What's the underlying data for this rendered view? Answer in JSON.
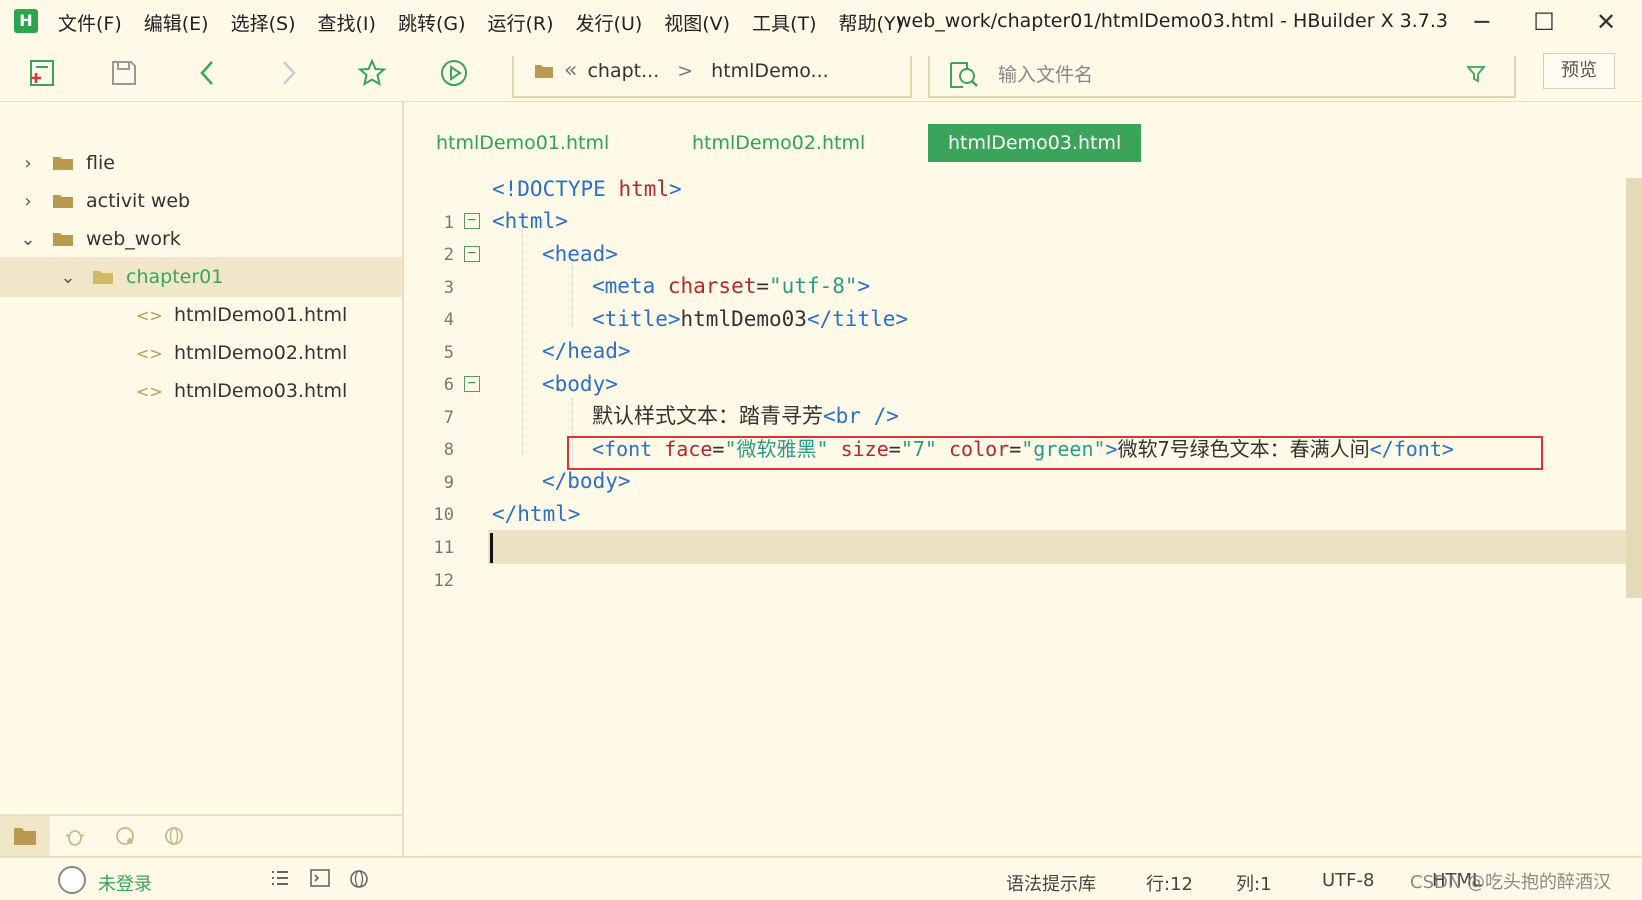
{
  "window": {
    "title": "web_work/chapter01/htmlDemo03.html - HBuilder X 3.7.3",
    "logo_text": "H",
    "minimize": "─",
    "maximize": "☐",
    "close": "✕"
  },
  "menu": [
    "文件(F)",
    "编辑(E)",
    "选择(S)",
    "查找(I)",
    "跳转(G)",
    "运行(R)",
    "发行(U)",
    "视图(V)",
    "工具(T)",
    "帮助(Y)"
  ],
  "breadcrumb": {
    "back_glyph": "«",
    "items": [
      "chapt...",
      "htmlDemo..."
    ],
    "separator": ">"
  },
  "search": {
    "placeholder": "输入文件名"
  },
  "toolbar": {
    "preview_label": "预览"
  },
  "sidebar": {
    "items": [
      {
        "label": "flie",
        "chevron": "›",
        "level": 0
      },
      {
        "label": "activit web",
        "chevron": "›",
        "level": 0
      },
      {
        "label": "web_work",
        "chevron": "⌄",
        "level": 0
      },
      {
        "label": "chapter01",
        "chevron": "⌄",
        "level": 1
      },
      {
        "label": "htmlDemo01.html",
        "icon": "<>",
        "level": 2
      },
      {
        "label": "htmlDemo02.html",
        "icon": "<>",
        "level": 2
      },
      {
        "label": "htmlDemo03.html",
        "icon": "<>",
        "level": 2
      }
    ]
  },
  "tabs": [
    "htmlDemo01.html",
    "htmlDemo02.html",
    "htmlDemo03.html"
  ],
  "editor": {
    "line_numbers": [
      "1",
      "2",
      "3",
      "4",
      "5",
      "6",
      "7",
      "8",
      "9",
      "10",
      "11",
      "12"
    ],
    "fold_marker": "−",
    "tokens": {
      "l1_a": "<!DOCTYPE ",
      "l1_b": "html",
      "l1_c": ">",
      "l2": "<html>",
      "l3": "<head>",
      "l4_a": "<meta ",
      "l4_b": "charset",
      "l4_c": "=",
      "l4_d": "\"utf-8\"",
      "l4_e": ">",
      "l5_a": "<title>",
      "l5_b": "htmlDemo03",
      "l5_c": "</title>",
      "l6": "</head>",
      "l7": "<body>",
      "l8_a": "默认样式文本：踏青寻芳",
      "l8_b": "<br />",
      "l9_a": "<font ",
      "l9_b": "face",
      "l9_c": "=",
      "l9_d": "\"微软雅黑\"",
      "l9_e": " size",
      "l9_f": "=",
      "l9_g": "\"7\"",
      "l9_h": " color",
      "l9_i": "=",
      "l9_j": "\"green\"",
      "l9_k": ">",
      "l9_l": "微软7号绿色文本：春满人间",
      "l9_m": "</font>",
      "l10": "</body>",
      "l11": "</html>"
    }
  },
  "status": {
    "login": "未登录",
    "syntax_lib": "语法提示库",
    "row": "行:12",
    "col": "列:1",
    "encoding": "UTF-8",
    "language": "HTML"
  },
  "watermark": "CSDN @吃头抱的醉酒汉",
  "colors": {
    "accent": "#3aa55a",
    "tag": "#2a6fc9",
    "attr": "#b02a2a",
    "string": "#2a9a8a",
    "highlight_border": "#e0303a"
  }
}
